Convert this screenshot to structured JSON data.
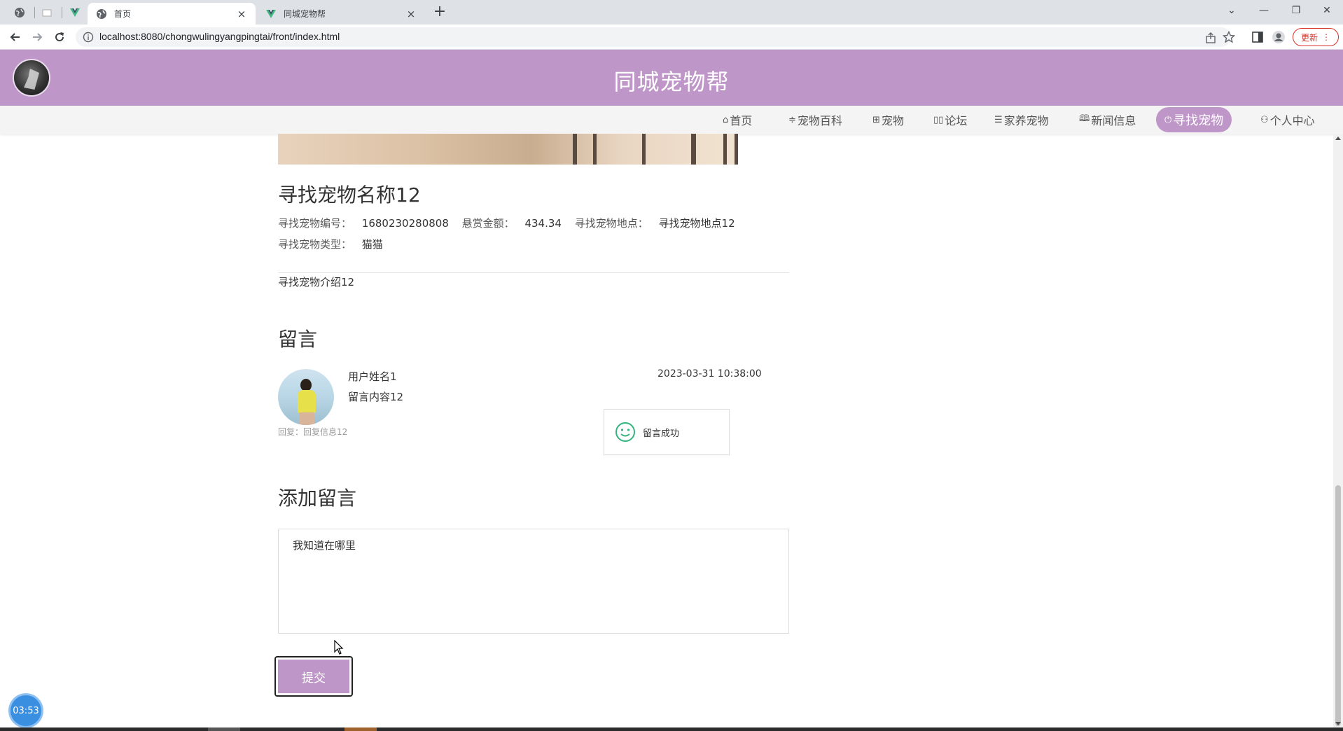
{
  "browser": {
    "tabs": [
      {
        "title": "首页",
        "active": true,
        "icon": "globe-icon"
      },
      {
        "title": "同城宠物帮",
        "active": false,
        "icon": "vue-icon"
      }
    ],
    "url": "localhost:8080/chongwulingyangpingtai/front/index.html",
    "update_label": "更新"
  },
  "site": {
    "title": "同城宠物帮",
    "accent_color": "#be96c8"
  },
  "nav": {
    "items": [
      {
        "label": "首页",
        "icon": "⌂"
      },
      {
        "label": "宠物百科",
        "icon": "≑"
      },
      {
        "label": "宠物",
        "icon": "⊞"
      },
      {
        "label": "论坛",
        "icon": "▯▯"
      },
      {
        "label": "家养宠物",
        "icon": "☰"
      },
      {
        "label": "新闻信息",
        "icon": "🕮"
      },
      {
        "label": "寻找宠物",
        "icon": "⏻",
        "active": true
      },
      {
        "label": "个人中心",
        "icon": "⚇"
      }
    ]
  },
  "detail": {
    "name": "寻找宠物名称12",
    "number_label": "寻找宠物编号：",
    "number": "1680230280808",
    "reward_label": "悬赏金额：",
    "reward": "434.34",
    "location_label": "寻找宠物地点：",
    "location": "寻找宠物地点12",
    "type_label": "寻找宠物类型：",
    "type": "猫猫",
    "intro": "寻找宠物介绍12"
  },
  "comments": {
    "heading": "留言",
    "items": [
      {
        "user": "用户姓名1",
        "content": "留言内容12",
        "time": "2023-03-31 10:38:00",
        "reply": "回复：回复信息12"
      }
    ]
  },
  "toast": {
    "message": "留言成功",
    "icon": "smile-icon"
  },
  "add_comment": {
    "heading": "添加留言",
    "value": "我知道在哪里",
    "submit_label": "提交"
  },
  "overlay": {
    "timer": "03:53"
  }
}
